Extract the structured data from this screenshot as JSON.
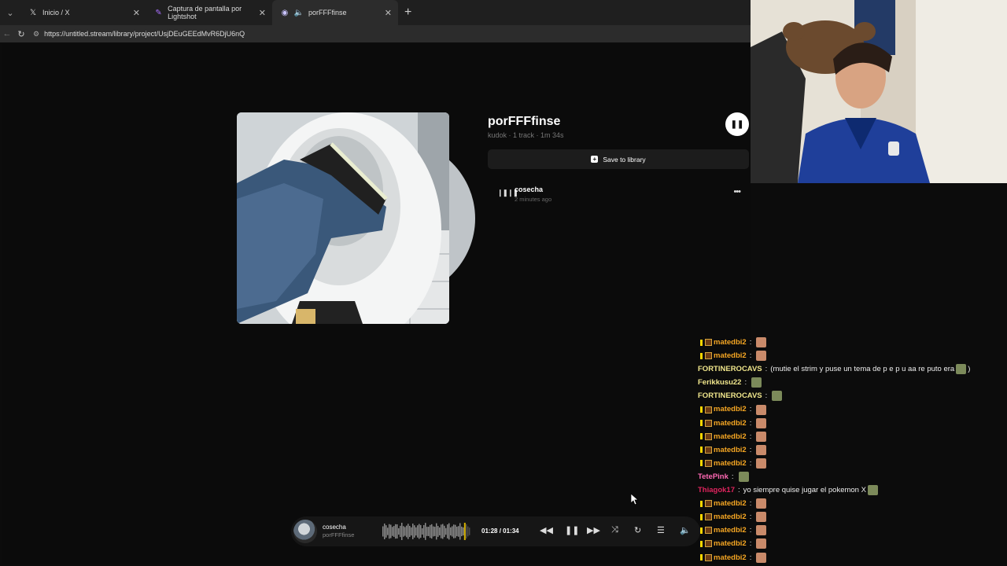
{
  "browser": {
    "tabs": [
      {
        "label": "Inicio / X",
        "icon": "x-logo-icon"
      },
      {
        "label": "Captura de pantalla por Lightshot",
        "icon": "feather-icon"
      },
      {
        "label": "porFFFfinse",
        "icon": "speaker-icon"
      }
    ],
    "url": "https://untitled.stream/library/project/UsjDEuGEEdMvR6DjU6nQ"
  },
  "project": {
    "title": "porFFFfinse",
    "meta": "kudok · 1 track · 1m 34s",
    "save_label": "Save to library"
  },
  "tracks": [
    {
      "name": "cosecha",
      "time": "2 minutes ago"
    }
  ],
  "player": {
    "title": "cosecha",
    "artist": "porFFFfinse",
    "current": "01:28",
    "separator": "/",
    "duration": "01:34",
    "progress": 0.936
  },
  "chat": [
    {
      "user": "matedbi2",
      "text": "",
      "color": "#f5a623",
      "badges": true
    },
    {
      "user": "matedbi2",
      "text": "",
      "color": "#f5a623",
      "badges": true
    },
    {
      "user": "FORTINEROCAVS",
      "text": "(mutie el strim y puse un tema de p e p u aa re puto era",
      "suffix": ")",
      "color": "#f0e68c",
      "badges": false
    },
    {
      "user": "Ferikkusu22",
      "text": "",
      "color": "#f0e68c",
      "badges": false
    },
    {
      "user": "FORTINEROCAVS",
      "text": "",
      "color": "#f0e68c",
      "badges": false
    },
    {
      "user": "matedbi2",
      "text": "",
      "color": "#f5a623",
      "badges": true
    },
    {
      "user": "matedbi2",
      "text": "",
      "color": "#f5a623",
      "badges": true
    },
    {
      "user": "matedbi2",
      "text": "",
      "color": "#f5a623",
      "badges": true
    },
    {
      "user": "matedbi2",
      "text": "",
      "color": "#f5a623",
      "badges": true
    },
    {
      "user": "matedbi2",
      "text": "",
      "color": "#f5a623",
      "badges": true
    },
    {
      "user": "TetePink",
      "text": "",
      "color": "#ff69b4",
      "badges": false
    },
    {
      "user": "Thiagok17",
      "text": "yo siempre quise jugar el pokemon X",
      "color": "#e0245e",
      "badges": false
    },
    {
      "user": "matedbi2",
      "text": "",
      "color": "#f5a623",
      "badges": true
    },
    {
      "user": "matedbi2",
      "text": "",
      "color": "#f5a623",
      "badges": true
    },
    {
      "user": "matedbi2",
      "text": "",
      "color": "#f5a623",
      "badges": true
    },
    {
      "user": "matedbi2",
      "text": "",
      "color": "#f5a623",
      "badges": true
    },
    {
      "user": "matedbi2",
      "text": "",
      "color": "#f5a623",
      "badges": true
    }
  ]
}
